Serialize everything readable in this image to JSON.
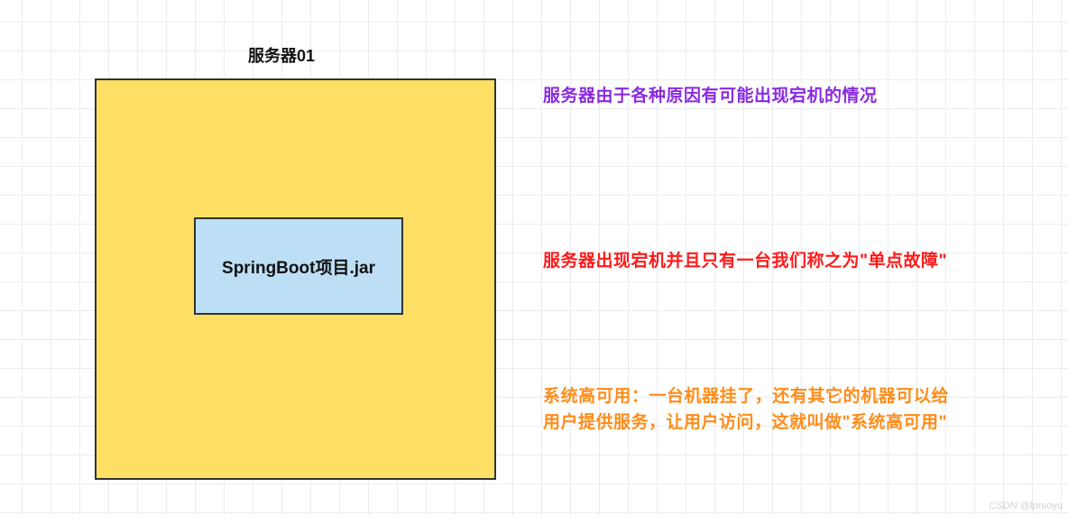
{
  "server": {
    "title": "服务器01",
    "jar_label": "SpringBoot项目.jar"
  },
  "notes": {
    "purple": "服务器由于各种原因有可能出现宕机的情况",
    "red": "服务器出现宕机并且只有一台我们称之为\"单点故障\"",
    "orange": "系统高可用：一台机器挂了，还有其它的机器可以给用户提供服务，让用户访问，这就叫做\"系统高可用\""
  },
  "watermark": "CSDN @lpruoyu",
  "colors": {
    "server_box_fill": "#ffe065",
    "jar_box_fill": "#bcdff5",
    "border": "#333333",
    "note_purple": "#8a2be2",
    "note_red": "#ff1a1a",
    "note_orange": "#ff8c1a",
    "grid_line": "#e9ecef"
  }
}
